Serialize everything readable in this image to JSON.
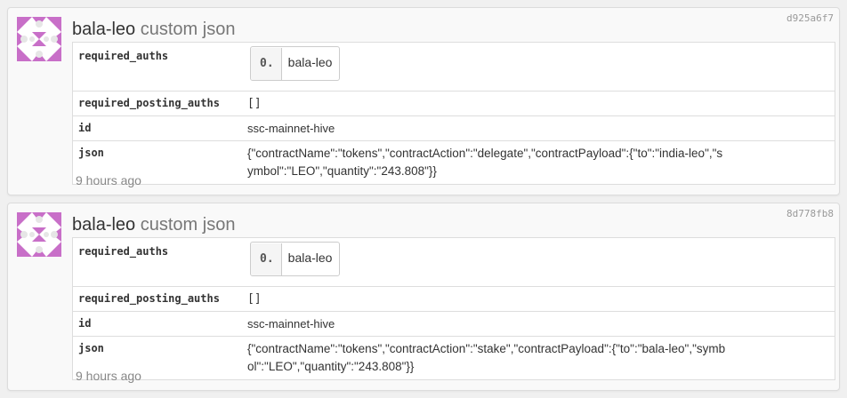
{
  "operations": [
    {
      "user": "bala-leo",
      "type_label": "custom json",
      "hash": "d925a6f7",
      "fields": {
        "required_auths_key": "required_auths",
        "required_auths_index": "0.",
        "required_auths_value": "bala-leo",
        "required_posting_auths_key": "required_posting_auths",
        "required_posting_auths_value": "[]",
        "id_key": "id",
        "id_value": "ssc-mainnet-hive",
        "json_key": "json",
        "json_value": "{\"contractName\":\"tokens\",\"contractAction\":\"delegate\",\"contractPayload\":{\"to\":\"india-leo\",\"symbol\":\"LEO\",\"quantity\":\"243.808\"}}"
      },
      "time": "9 hours ago"
    },
    {
      "user": "bala-leo",
      "type_label": "custom json",
      "hash": "8d778fb8",
      "fields": {
        "required_auths_key": "required_auths",
        "required_auths_index": "0.",
        "required_auths_value": "bala-leo",
        "required_posting_auths_key": "required_posting_auths",
        "required_posting_auths_value": "[]",
        "id_key": "id",
        "id_value": "ssc-mainnet-hive",
        "json_key": "json",
        "json_value": "{\"contractName\":\"tokens\",\"contractAction\":\"stake\",\"contractPayload\":{\"to\":\"bala-leo\",\"symbol\":\"LEO\",\"quantity\":\"243.808\"}}"
      },
      "time": "9 hours ago"
    }
  ],
  "colors": {
    "avatar_pink": "#c86fc8",
    "avatar_grey": "#e6e6e6",
    "card_bg": "#f9f9f9",
    "border": "#dddddd"
  },
  "icons": {
    "avatar": "identicon-avatar"
  }
}
